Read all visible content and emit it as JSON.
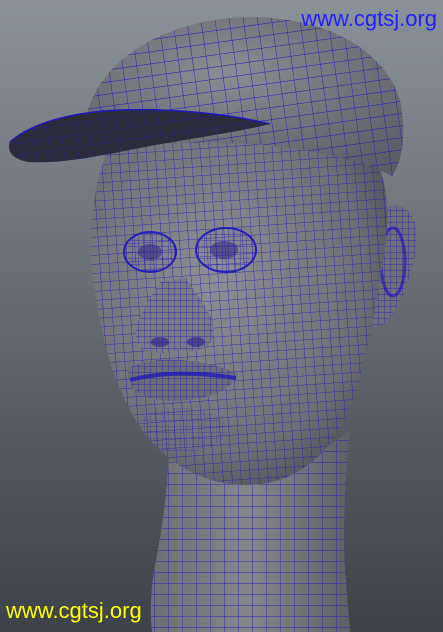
{
  "viewport": {
    "background_top": "#8a9299",
    "background_bottom": "#3c4247",
    "mesh_fill": "#7d7d82",
    "mesh_shadow": "#3e3e46",
    "wire_color": "#1f1ab8"
  },
  "subject_icon": "wireframe-head-with-cap",
  "watermark_top": {
    "text": "www.cgtsj.org",
    "color": "#1f1fff"
  },
  "watermark_bottom": {
    "text": "www.cgtsj.org",
    "color": "#ffff00"
  }
}
